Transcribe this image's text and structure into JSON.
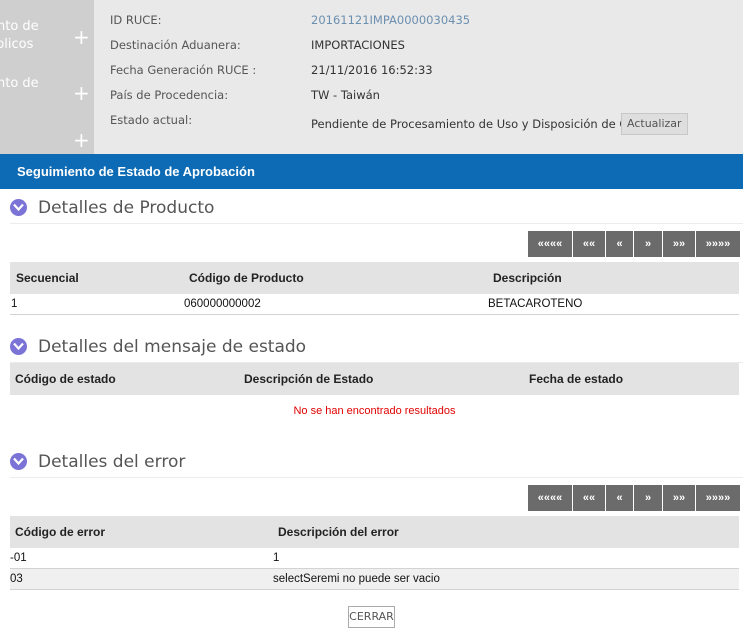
{
  "sidebar": {
    "line1": "nto de",
    "line2": "blicos",
    "line3": "nto de",
    "plus": "+"
  },
  "info": {
    "rows": [
      {
        "label": "ID RUCE:",
        "value": "20161121IMPA0000030435"
      },
      {
        "label": "Destinación Aduanera:",
        "value": "IMPORTACIONES"
      },
      {
        "label": "Fecha Generación RUCE :",
        "value": "21/11/2016 16:52:33"
      },
      {
        "label": "País de Procedencia:",
        "value": "TW - Taiwán"
      },
      {
        "label": "Estado actual:",
        "value": "Pendiente de Procesamiento de Uso y Disposición de OIG(s)"
      }
    ],
    "refresh_label": "Actualizar"
  },
  "page_title": "Seguimiento de Estado de Aprobación",
  "pager_labels": [
    "««««",
    "««",
    "«",
    "»",
    "»»",
    "»»»»"
  ],
  "products": {
    "title": "Detalles de Producto",
    "headers": [
      "Secuencial",
      "Código de Producto",
      "Descripción"
    ],
    "rows": [
      [
        "1",
        "060000000002",
        "BETACAROTENO"
      ]
    ]
  },
  "status_messages": {
    "title": "Detalles del mensaje de estado",
    "headers": [
      "Código de estado",
      "Descripción de Estado",
      "Fecha de estado"
    ],
    "empty_text": "No se han encontrado resultados"
  },
  "errors": {
    "title": "Detalles del error",
    "headers": [
      "Código de error",
      "Descripción del error"
    ],
    "rows": [
      [
        "-01",
        "1"
      ],
      [
        "03",
        "selectSeremi no puede ser vacio"
      ]
    ]
  },
  "close_label": "CERRAR",
  "colors": {
    "header_bar": "#0d6bb5",
    "pager": "#6b6b6b",
    "chevron": "#7b73d6",
    "empty_text": "#e00000"
  }
}
